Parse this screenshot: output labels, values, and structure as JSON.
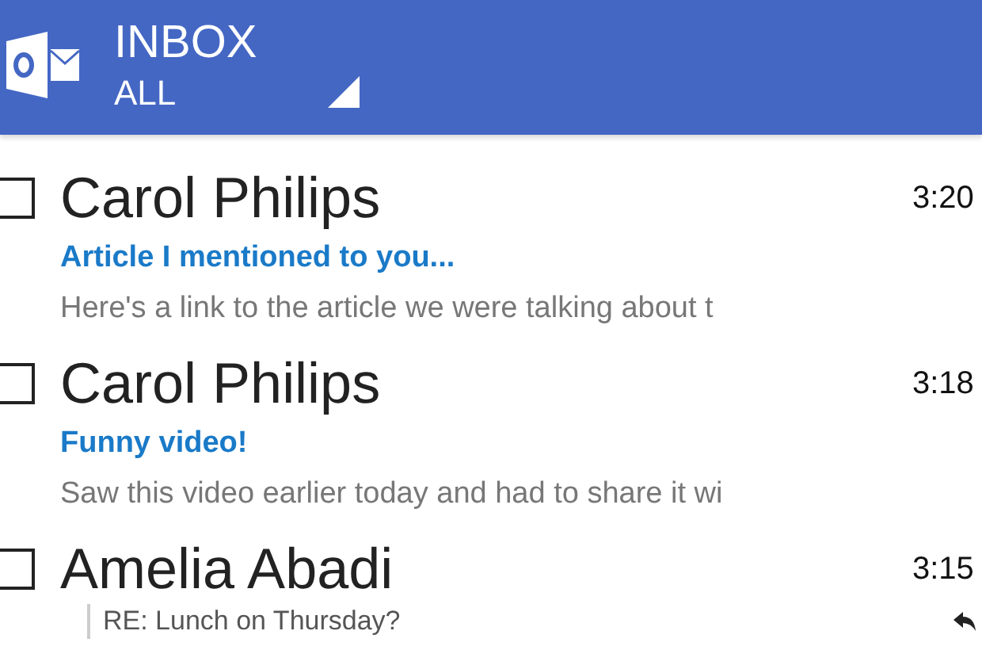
{
  "header": {
    "title": "INBOX",
    "filter": "ALL"
  },
  "messages": [
    {
      "sender": "Carol Philips",
      "time": "3:20",
      "subject": "Article I mentioned to you...",
      "preview": "Here's a link to the article we were talking about t",
      "checked": false
    },
    {
      "sender": "Carol Philips",
      "time": "3:18",
      "subject": "Funny video!",
      "preview": "Saw this video earlier today and had to share it wi",
      "checked": false
    },
    {
      "sender": "Amelia Abadi",
      "time": "3:15",
      "thread": "RE: Lunch on Thursday?",
      "checked": false
    }
  ]
}
